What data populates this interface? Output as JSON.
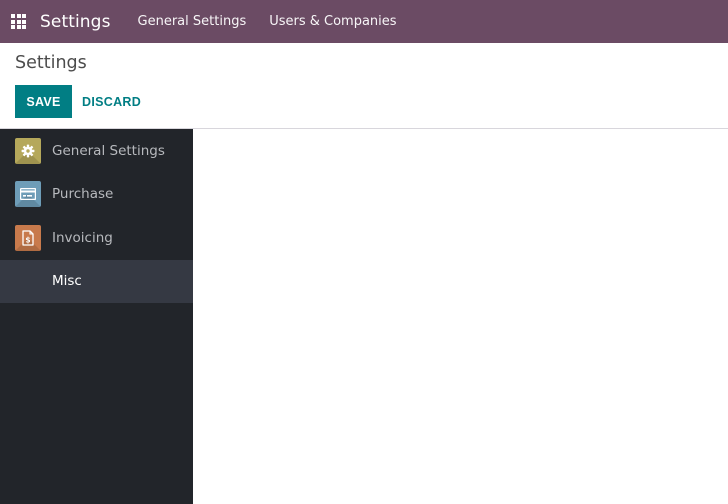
{
  "navbar": {
    "apps_icon": "grid-icon",
    "brand": "Settings",
    "menu": [
      {
        "label": "General Settings"
      },
      {
        "label": "Users & Companies"
      }
    ],
    "background_color": "#6B4B64"
  },
  "control_panel": {
    "breadcrumb": "Settings",
    "save_label": "SAVE",
    "discard_label": "DISCARD",
    "accent_color": "#017E84"
  },
  "sidebar": {
    "items": [
      {
        "label": "General Settings",
        "icon": "gear-icon",
        "icon_color": "#B5A85B",
        "active": false
      },
      {
        "label": "Purchase",
        "icon": "credit-card-icon",
        "icon_color": "#6E9DB8",
        "active": false
      },
      {
        "label": "Invoicing",
        "icon": "invoice-dollar-icon",
        "icon_color": "#C87A4C",
        "active": false
      },
      {
        "label": "Misc",
        "icon": "",
        "icon_color": "",
        "active": true
      }
    ]
  }
}
